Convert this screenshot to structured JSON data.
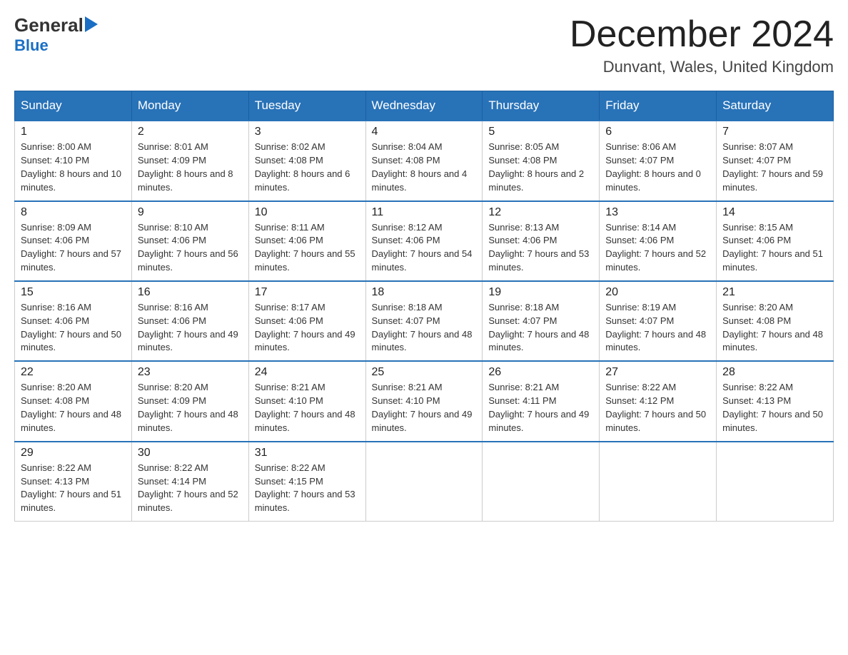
{
  "logo": {
    "line1": "General",
    "arrow": "▶",
    "line2": "Blue"
  },
  "title": "December 2024",
  "location": "Dunvant, Wales, United Kingdom",
  "days_of_week": [
    "Sunday",
    "Monday",
    "Tuesday",
    "Wednesday",
    "Thursday",
    "Friday",
    "Saturday"
  ],
  "weeks": [
    [
      {
        "day": "1",
        "sunrise": "8:00 AM",
        "sunset": "4:10 PM",
        "daylight": "8 hours and 10 minutes."
      },
      {
        "day": "2",
        "sunrise": "8:01 AM",
        "sunset": "4:09 PM",
        "daylight": "8 hours and 8 minutes."
      },
      {
        "day": "3",
        "sunrise": "8:02 AM",
        "sunset": "4:08 PM",
        "daylight": "8 hours and 6 minutes."
      },
      {
        "day": "4",
        "sunrise": "8:04 AM",
        "sunset": "4:08 PM",
        "daylight": "8 hours and 4 minutes."
      },
      {
        "day": "5",
        "sunrise": "8:05 AM",
        "sunset": "4:08 PM",
        "daylight": "8 hours and 2 minutes."
      },
      {
        "day": "6",
        "sunrise": "8:06 AM",
        "sunset": "4:07 PM",
        "daylight": "8 hours and 0 minutes."
      },
      {
        "day": "7",
        "sunrise": "8:07 AM",
        "sunset": "4:07 PM",
        "daylight": "7 hours and 59 minutes."
      }
    ],
    [
      {
        "day": "8",
        "sunrise": "8:09 AM",
        "sunset": "4:06 PM",
        "daylight": "7 hours and 57 minutes."
      },
      {
        "day": "9",
        "sunrise": "8:10 AM",
        "sunset": "4:06 PM",
        "daylight": "7 hours and 56 minutes."
      },
      {
        "day": "10",
        "sunrise": "8:11 AM",
        "sunset": "4:06 PM",
        "daylight": "7 hours and 55 minutes."
      },
      {
        "day": "11",
        "sunrise": "8:12 AM",
        "sunset": "4:06 PM",
        "daylight": "7 hours and 54 minutes."
      },
      {
        "day": "12",
        "sunrise": "8:13 AM",
        "sunset": "4:06 PM",
        "daylight": "7 hours and 53 minutes."
      },
      {
        "day": "13",
        "sunrise": "8:14 AM",
        "sunset": "4:06 PM",
        "daylight": "7 hours and 52 minutes."
      },
      {
        "day": "14",
        "sunrise": "8:15 AM",
        "sunset": "4:06 PM",
        "daylight": "7 hours and 51 minutes."
      }
    ],
    [
      {
        "day": "15",
        "sunrise": "8:16 AM",
        "sunset": "4:06 PM",
        "daylight": "7 hours and 50 minutes."
      },
      {
        "day": "16",
        "sunrise": "8:16 AM",
        "sunset": "4:06 PM",
        "daylight": "7 hours and 49 minutes."
      },
      {
        "day": "17",
        "sunrise": "8:17 AM",
        "sunset": "4:06 PM",
        "daylight": "7 hours and 49 minutes."
      },
      {
        "day": "18",
        "sunrise": "8:18 AM",
        "sunset": "4:07 PM",
        "daylight": "7 hours and 48 minutes."
      },
      {
        "day": "19",
        "sunrise": "8:18 AM",
        "sunset": "4:07 PM",
        "daylight": "7 hours and 48 minutes."
      },
      {
        "day": "20",
        "sunrise": "8:19 AM",
        "sunset": "4:07 PM",
        "daylight": "7 hours and 48 minutes."
      },
      {
        "day": "21",
        "sunrise": "8:20 AM",
        "sunset": "4:08 PM",
        "daylight": "7 hours and 48 minutes."
      }
    ],
    [
      {
        "day": "22",
        "sunrise": "8:20 AM",
        "sunset": "4:08 PM",
        "daylight": "7 hours and 48 minutes."
      },
      {
        "day": "23",
        "sunrise": "8:20 AM",
        "sunset": "4:09 PM",
        "daylight": "7 hours and 48 minutes."
      },
      {
        "day": "24",
        "sunrise": "8:21 AM",
        "sunset": "4:10 PM",
        "daylight": "7 hours and 48 minutes."
      },
      {
        "day": "25",
        "sunrise": "8:21 AM",
        "sunset": "4:10 PM",
        "daylight": "7 hours and 49 minutes."
      },
      {
        "day": "26",
        "sunrise": "8:21 AM",
        "sunset": "4:11 PM",
        "daylight": "7 hours and 49 minutes."
      },
      {
        "day": "27",
        "sunrise": "8:22 AM",
        "sunset": "4:12 PM",
        "daylight": "7 hours and 50 minutes."
      },
      {
        "day": "28",
        "sunrise": "8:22 AM",
        "sunset": "4:13 PM",
        "daylight": "7 hours and 50 minutes."
      }
    ],
    [
      {
        "day": "29",
        "sunrise": "8:22 AM",
        "sunset": "4:13 PM",
        "daylight": "7 hours and 51 minutes."
      },
      {
        "day": "30",
        "sunrise": "8:22 AM",
        "sunset": "4:14 PM",
        "daylight": "7 hours and 52 minutes."
      },
      {
        "day": "31",
        "sunrise": "8:22 AM",
        "sunset": "4:15 PM",
        "daylight": "7 hours and 53 minutes."
      },
      null,
      null,
      null,
      null
    ]
  ]
}
